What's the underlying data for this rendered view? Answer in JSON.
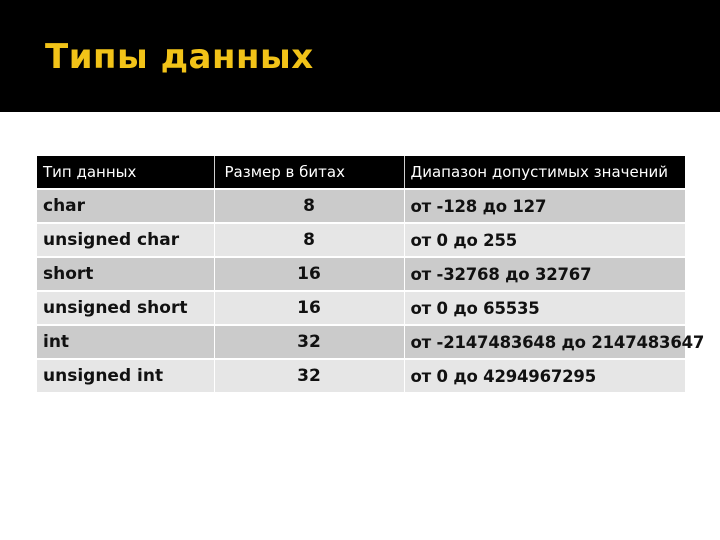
{
  "slide": {
    "title": "Типы данных",
    "colors": {
      "title_band": "#000000",
      "title_text": "#f2c318",
      "header_bg": "#000000",
      "header_text": "#ffffff",
      "row_dark": "#cbcbcb",
      "row_light": "#e6e6e6"
    }
  },
  "table": {
    "headers": [
      "Тип данных",
      "Размер в битах",
      "Диапазон допустимых значений"
    ],
    "rows": [
      {
        "type": "char",
        "bits": "8",
        "range": "от -128 до 127"
      },
      {
        "type": "unsigned char",
        "bits": "8",
        "range": "от 0 до 255"
      },
      {
        "type": "short",
        "bits": "16",
        "range": "от -32768 до 32767"
      },
      {
        "type": "unsigned short",
        "bits": "16",
        "range": "от 0 до 65535"
      },
      {
        "type": "int",
        "bits": "32",
        "range": "от -2147483648 до 2147483647"
      },
      {
        "type": "unsigned int",
        "bits": "32",
        "range": "от 0 до 4294967295"
      }
    ]
  }
}
